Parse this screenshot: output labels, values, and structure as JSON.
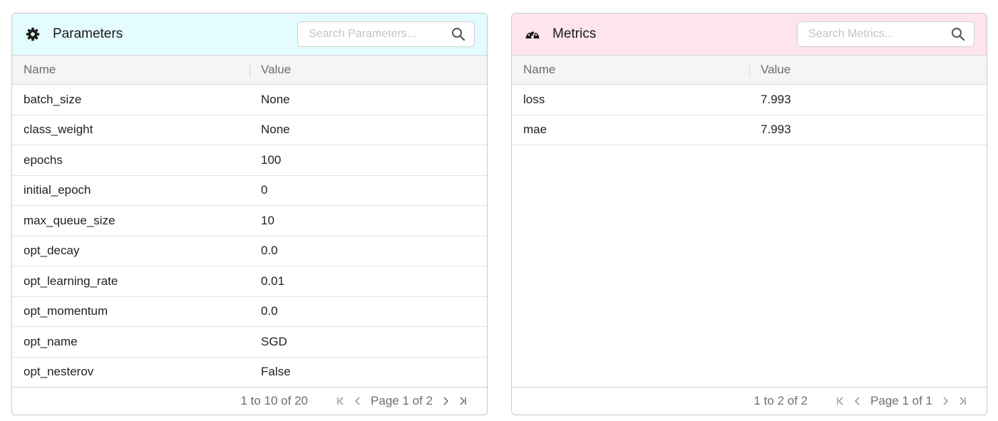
{
  "parameters": {
    "title": "Parameters",
    "icon": "gear-icon",
    "search_placeholder": "Search Parameters...",
    "columns": [
      "Name",
      "Value"
    ],
    "rows": [
      {
        "name": "batch_size",
        "value": "None"
      },
      {
        "name": "class_weight",
        "value": "None"
      },
      {
        "name": "epochs",
        "value": "100"
      },
      {
        "name": "initial_epoch",
        "value": "0"
      },
      {
        "name": "max_queue_size",
        "value": "10"
      },
      {
        "name": "opt_decay",
        "value": "0.0"
      },
      {
        "name": "opt_learning_rate",
        "value": "0.01"
      },
      {
        "name": "opt_momentum",
        "value": "0.0"
      },
      {
        "name": "opt_name",
        "value": "SGD"
      },
      {
        "name": "opt_nesterov",
        "value": "False"
      }
    ],
    "range_text": "1 to 10 of 20",
    "page_text": "Page 1 of 2",
    "header_color": "#e4fcfd"
  },
  "metrics": {
    "title": "Metrics",
    "icon": "dashboard-icon",
    "search_placeholder": "Search Metrics...",
    "columns": [
      "Name",
      "Value"
    ],
    "rows": [
      {
        "name": "loss",
        "value": "7.993"
      },
      {
        "name": "mae",
        "value": "7.993"
      }
    ],
    "range_text": "1 to 2 of 2",
    "page_text": "Page 1 of 1",
    "header_color": "#fde4ed"
  }
}
